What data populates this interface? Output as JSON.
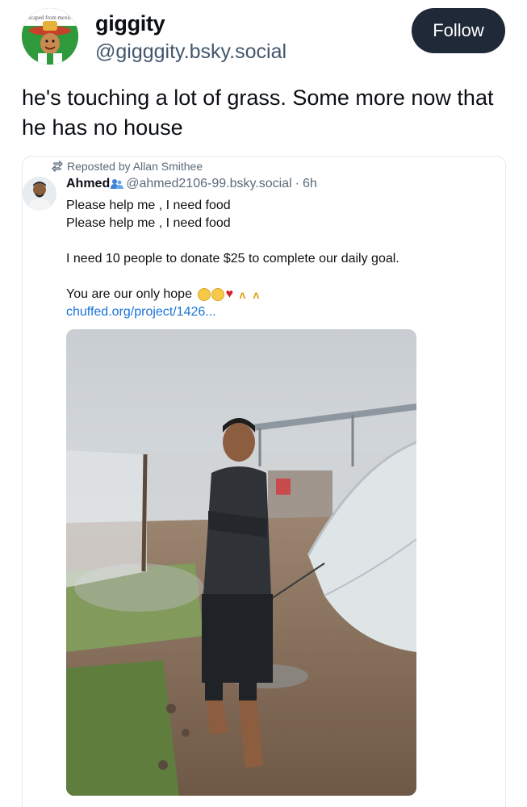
{
  "author": {
    "display_name": "giggity",
    "handle": "@gigggity.bsky.social",
    "avatar_caption": "scaped from mexic"
  },
  "follow_label": "Follow",
  "post_text": "he's touching a lot of grass. Some more now that he has no house",
  "embed": {
    "repost_label": "Reposted by Allan Smithee",
    "name": "Ahmed",
    "handle": "@ahmed2106-99.bsky.social",
    "separator": "·",
    "time": "6h",
    "lines": [
      "Please help me , I need food",
      "Please help me , I need food",
      "I need 10 people to donate $25 to complete our daily goal.",
      "You are our only hope"
    ],
    "link": "chuffed.org/project/1426..."
  },
  "icons": [
    "repost-icon",
    "verified-people-icon",
    "pleading-face-emoji",
    "broken-heart-emoji",
    "praying-hands-emoji"
  ],
  "colors": {
    "follow_bg": "#1f2937",
    "link": "#1a73d9",
    "handle": "#42576c",
    "avatar_bg": "#2f9a3c"
  }
}
